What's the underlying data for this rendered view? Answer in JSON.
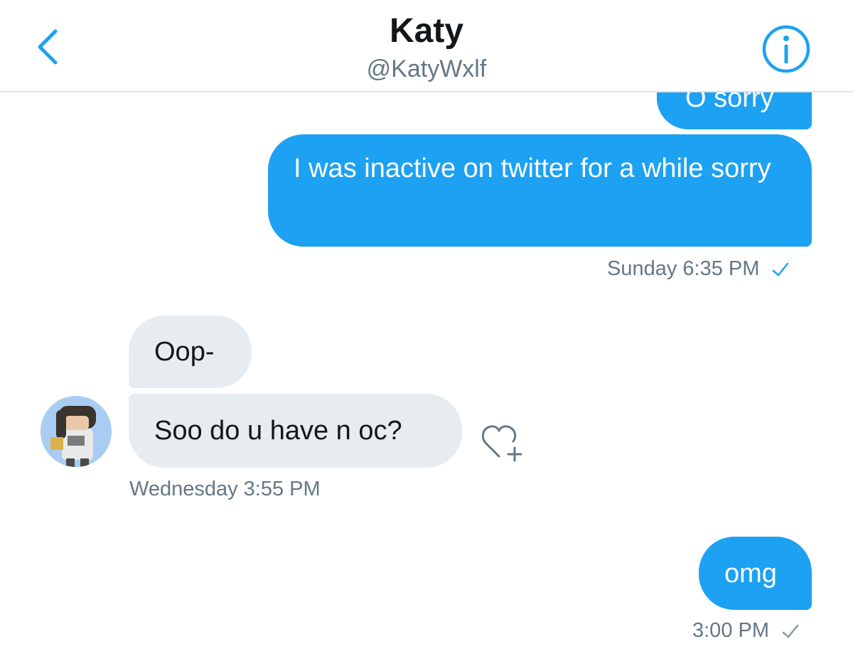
{
  "header": {
    "name": "Katy",
    "handle": "@KatyWxlf",
    "back_icon": "chevron-left-icon",
    "info_icon": "info-circle-icon",
    "accent": "#1da1f2"
  },
  "messages": [
    {
      "direction": "outgoing",
      "text": "O sorry"
    },
    {
      "direction": "outgoing",
      "text": "I was inactive on twitter for a while sorry",
      "meta": "Sunday 6:35 PM",
      "status_icon": "check-icon",
      "status_color": "#1da1f2"
    },
    {
      "direction": "incoming",
      "text": "Oop-"
    },
    {
      "direction": "incoming",
      "text": "Soo do u have n oc?",
      "meta": "Wednesday 3:55 PM",
      "reaction_icon": "heart-plus-icon"
    },
    {
      "direction": "outgoing",
      "text": "omg",
      "meta": "3:00 PM",
      "status_icon": "check-icon",
      "status_color": "#8899a6"
    }
  ],
  "colors": {
    "outgoing_bubble": "#1da1f2",
    "incoming_bubble": "#e6ecf0",
    "meta_text": "#657786"
  }
}
